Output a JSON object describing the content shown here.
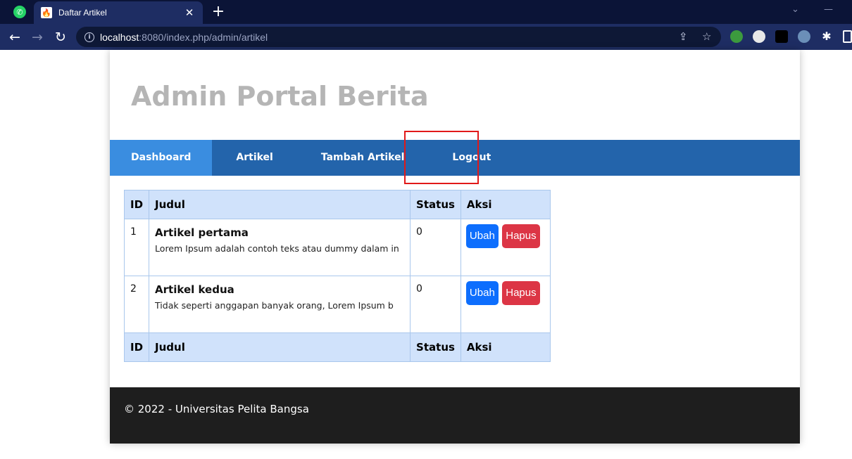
{
  "browser": {
    "tab_title": "Daftar Artikel",
    "tab_close": "✕",
    "new_tab": "+",
    "url_host": "localhost",
    "url_rest": ":8080/index.php/admin/artikel"
  },
  "site": {
    "title": "Admin Portal Berita"
  },
  "nav": {
    "items": [
      {
        "label": "Dashboard"
      },
      {
        "label": "Artikel"
      },
      {
        "label": "Tambah Artikel"
      },
      {
        "label": "Logout"
      }
    ]
  },
  "table": {
    "headers": [
      "ID",
      "Judul",
      "Status",
      "Aksi"
    ],
    "rows": [
      {
        "id": "1",
        "title": "Artikel pertama",
        "desc": "Lorem Ipsum adalah contoh teks atau dummy dalam in",
        "status": "0"
      },
      {
        "id": "2",
        "title": "Artikel kedua",
        "desc": "Tidak seperti anggapan banyak orang, Lorem Ipsum b",
        "status": "0"
      }
    ],
    "edit_label": "Ubah",
    "delete_label": "Hapus"
  },
  "footer": {
    "text": "© 2022 - Universitas Pelita Bangsa"
  },
  "colors": {
    "navbar": "#2364ab",
    "nav_active": "#3a8de0",
    "highlight_box": "#e11919",
    "table_header": "#d0e2fb",
    "btn_edit": "#0d6efd",
    "btn_delete": "#dc3545",
    "footer_bg": "#1e1e1e"
  }
}
